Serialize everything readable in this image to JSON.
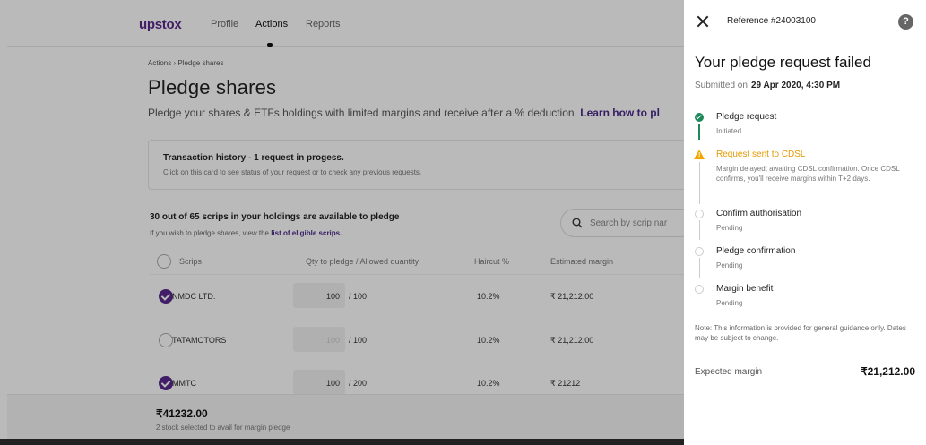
{
  "background": {
    "logo": "upstox",
    "nav": [
      "Profile",
      "Actions",
      "Reports"
    ],
    "breadcrumb": "Actions  ›  Pledge shares",
    "title": "Pledge shares",
    "subtitle": "Pledge your shares & ETFs holdings with limited margins and receive after a % deduction.",
    "learn_more": "Learn how to pl",
    "history_title": "Transaction history - 1 request in progess.",
    "history_desc": "Click on this card to see status of your request or to check any previous requests.",
    "avail_title": "30 out of 65 scrips in your holdings are available to pledge",
    "avail_desc": "If you wish to pledge shares, view the",
    "avail_link": "list of eligible scrips.",
    "search_placeholder": "Search by scrip nar",
    "columns": [
      "Scrips",
      "Qty to pledge  / Allowed quantity",
      "Haircut %",
      "Estimated margin"
    ],
    "rows": [
      {
        "name": "NMDC LTD.",
        "qty": "100",
        "allowed": "/ 100",
        "haircut": "10.2%",
        "margin": "₹ 21,212.00",
        "checked": true
      },
      {
        "name": "TATAMOTORS",
        "qty": "100",
        "allowed": "/ 100",
        "haircut": "10.2%",
        "margin": "₹ 21,212.00",
        "checked": false
      },
      {
        "name": "MMTC",
        "qty": "100",
        "allowed": "/ 200",
        "haircut": "10.2%",
        "margin": "₹ 21212",
        "checked": true
      }
    ],
    "bottom_total": "₹41232.00",
    "bottom_desc": "2 stock selected to avail for margin pledge"
  },
  "panel": {
    "reference": "Reference #24003100",
    "help": "?",
    "title": "Your pledge request failed",
    "submitted_label": "Submitted on",
    "submitted_date": "29 Apr 2020, 4:30 PM",
    "steps": [
      {
        "title": "Pledge request",
        "sub": "Initiated",
        "state": "done"
      },
      {
        "title": "Request sent to CDSL",
        "sub": "Margin delayed; awaiting CDSL confirmation. Once CDSL confirms, you'll receive margins within T+2 days.",
        "state": "warn"
      },
      {
        "title": "Confirm authorisation",
        "sub": "Pending",
        "state": "pending"
      },
      {
        "title": "Pledge confirmation",
        "sub": "Pending",
        "state": "pending"
      },
      {
        "title": "Margin benefit",
        "sub": "Pending",
        "state": "pending"
      }
    ],
    "note": "Note: This information is provided for general guidance only. Dates may be subject to change.",
    "expected_label": "Expected margin",
    "expected_value": "₹21,212.00"
  },
  "colors": {
    "accent": "#5a2a8e",
    "success": "#1e8a5a",
    "warning": "#e39a00"
  }
}
